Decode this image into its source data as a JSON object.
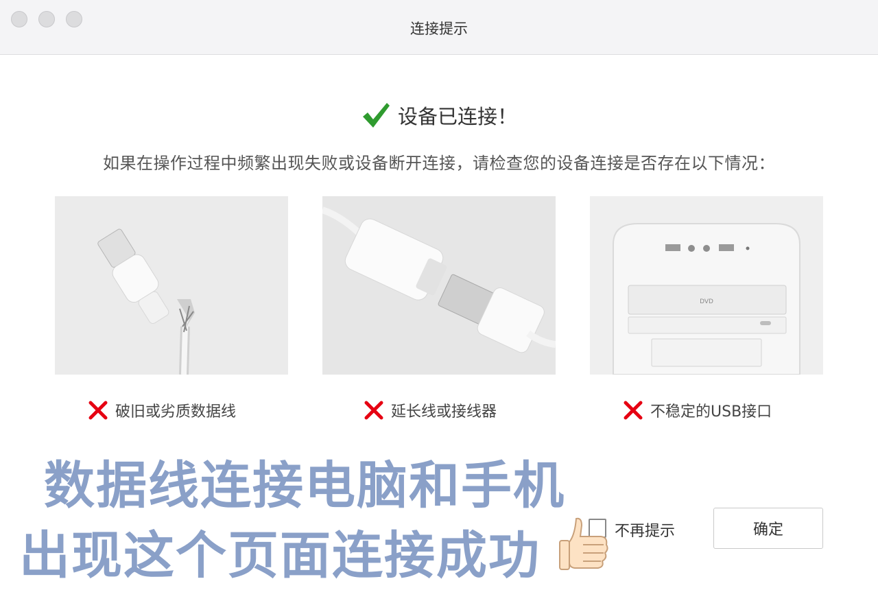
{
  "window": {
    "title": "连接提示"
  },
  "status": {
    "icon": "green-check-icon",
    "text": "设备已连接！",
    "color": "#2f9b2f"
  },
  "instruction": "如果在操作过程中频繁出现失败或设备断开连接，请检查您的设备连接是否存在以下情况：",
  "issues": [
    {
      "image": "broken-cable-image",
      "icon": "red-x-icon",
      "label": "破旧或劣质数据线"
    },
    {
      "image": "usb-extension-image",
      "icon": "red-x-icon",
      "label": "延长线或接线器"
    },
    {
      "image": "pc-front-usb-image",
      "icon": "red-x-icon",
      "label": "不稳定的USB接口"
    }
  ],
  "overlay": {
    "line1": "数据线连接电脑和手机",
    "line2": "出现这个页面连接成功",
    "emoji": "thumbs-up-icon",
    "color": "#8aa0c8"
  },
  "footer": {
    "dont_show_label": "不再提示",
    "dont_show_checked": false,
    "ok_label": "确定"
  }
}
